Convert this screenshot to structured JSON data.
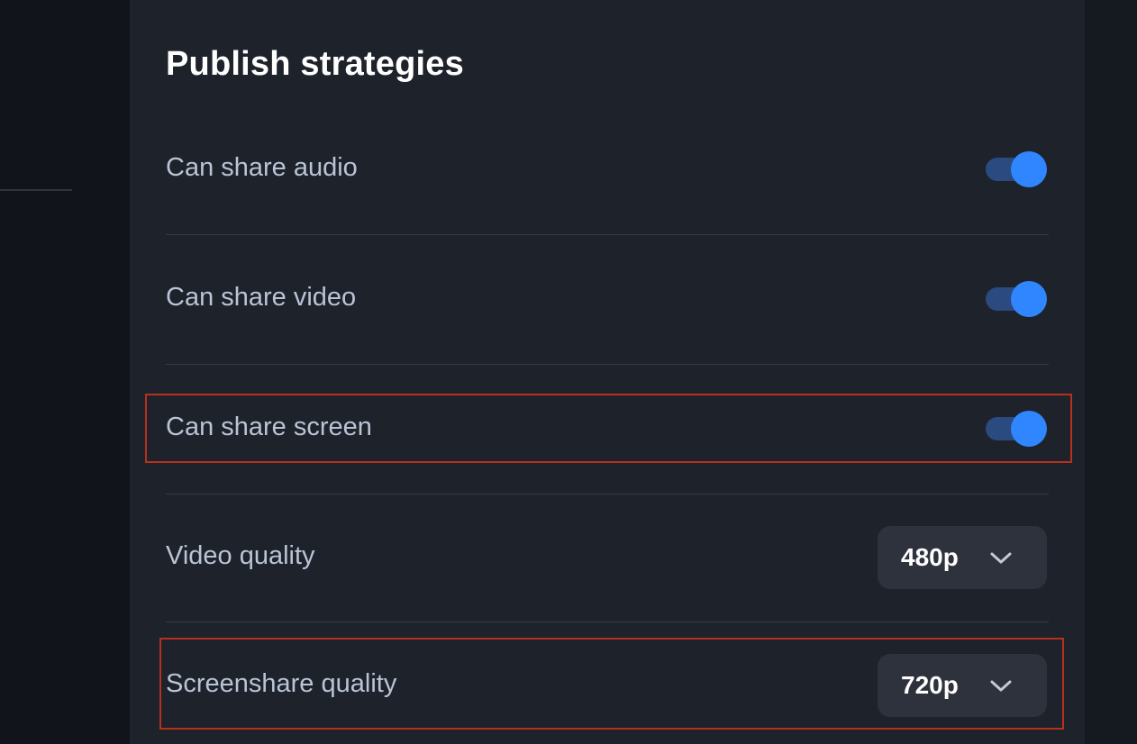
{
  "panel": {
    "title": "Publish strategies",
    "rows": [
      {
        "label": "Can share audio",
        "control": "toggle",
        "enabled": true
      },
      {
        "label": "Can share video",
        "control": "toggle",
        "enabled": true
      },
      {
        "label": "Can share screen",
        "control": "toggle",
        "enabled": true,
        "highlighted": true
      },
      {
        "label": "Video quality",
        "control": "select",
        "value": "480p"
      },
      {
        "label": "Screenshare quality",
        "control": "select",
        "value": "720p",
        "highlighted": true
      }
    ]
  },
  "colors": {
    "background": "#1e222a",
    "accent": "#2f86ff",
    "toggle_track": "#2a4a80",
    "highlight_border": "#b8301e",
    "label_text": "#b9c4d6"
  },
  "icons": {
    "select_chevron": "chevron-down-icon"
  }
}
